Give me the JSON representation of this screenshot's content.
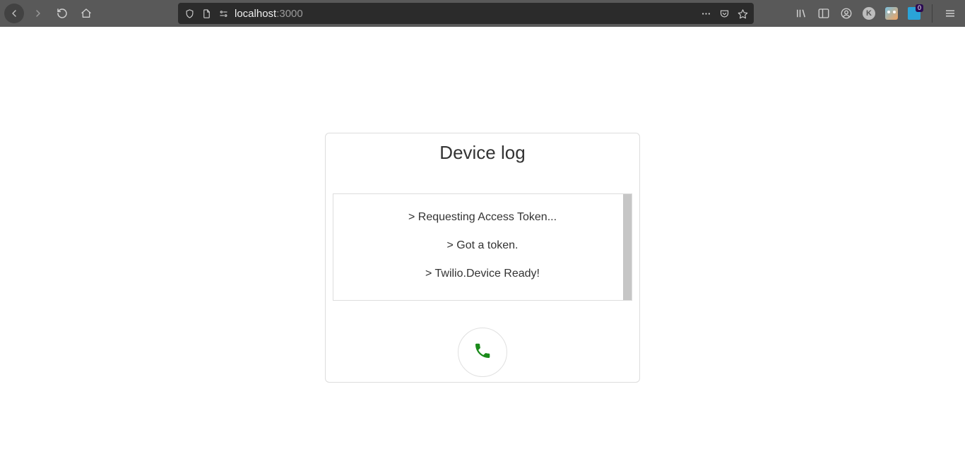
{
  "browser": {
    "url_host": "localhost",
    "url_port": ":3000",
    "ext_badge": "0",
    "avatar_letter": "K"
  },
  "card": {
    "title": "Device log",
    "log": {
      "line1": "> Requesting Access Token...",
      "line2": "> Got a token.",
      "line3": "> Twilio.Device Ready!"
    }
  }
}
